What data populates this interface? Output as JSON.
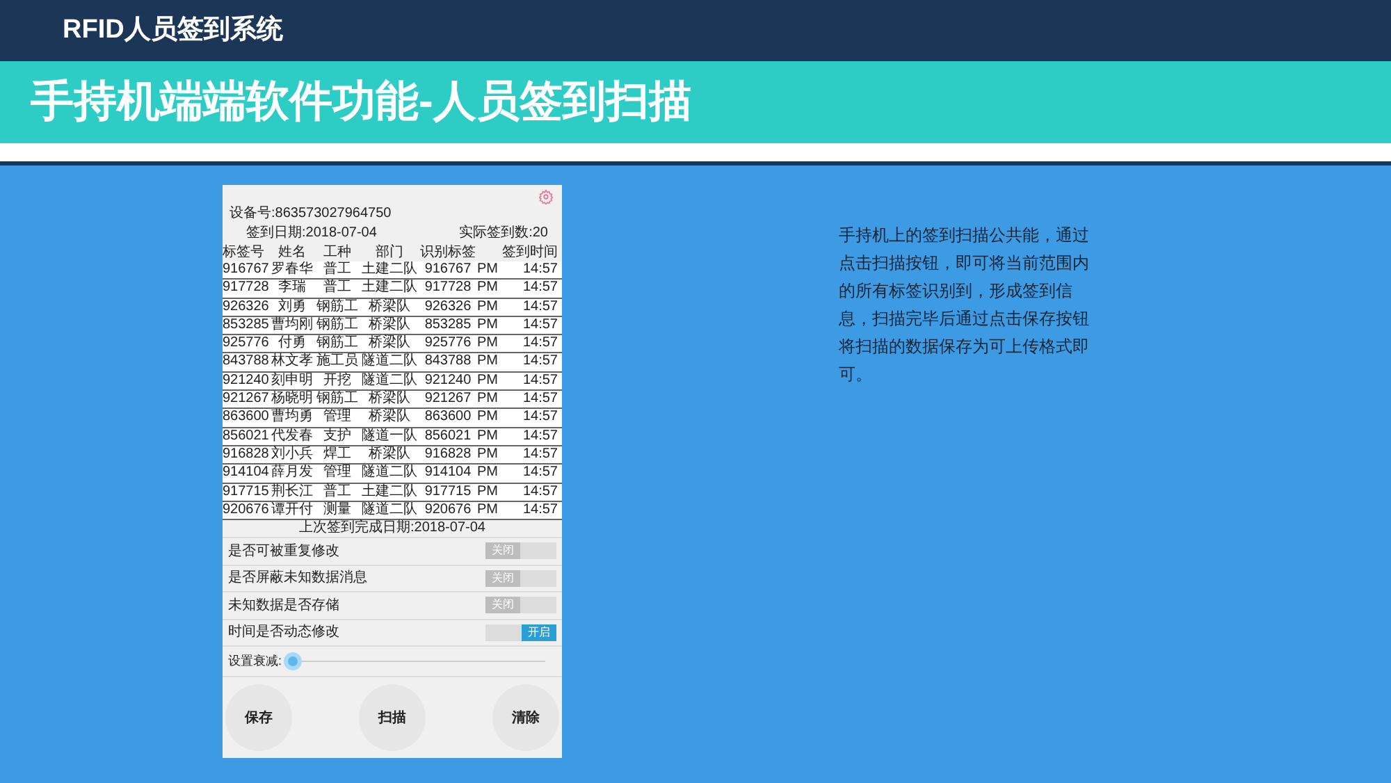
{
  "header": {
    "title": "RFID人员签到系统"
  },
  "banner": {
    "title": "手持机端端软件功能-人员签到扫描"
  },
  "phone": {
    "device": "设备号:863573027964750",
    "date": "签到日期:2018-07-04",
    "count": "实际签到数:20",
    "columns": [
      "标签号",
      "姓名",
      "工种",
      "部门",
      "识别标签",
      "签到时间"
    ],
    "rows": [
      {
        "tag": "916767",
        "name": "罗春华",
        "type": "普工",
        "dept": "土建二队",
        "id": "916767",
        "ampm": "PM",
        "time": "14:57"
      },
      {
        "tag": "917728",
        "name": "李瑞",
        "type": "普工",
        "dept": "土建二队",
        "id": "917728",
        "ampm": "PM",
        "time": "14:57"
      },
      {
        "tag": "926326",
        "name": "刘勇",
        "type": "钢筋工",
        "dept": "桥梁队",
        "id": "926326",
        "ampm": "PM",
        "time": "14:57"
      },
      {
        "tag": "853285",
        "name": "曹均刚",
        "type": "钢筋工",
        "dept": "桥梁队",
        "id": "853285",
        "ampm": "PM",
        "time": "14:57"
      },
      {
        "tag": "925776",
        "name": "付勇",
        "type": "钢筋工",
        "dept": "桥梁队",
        "id": "925776",
        "ampm": "PM",
        "time": "14:57"
      },
      {
        "tag": "843788",
        "name": "林文孝",
        "type": "施工员",
        "dept": "隧道二队",
        "id": "843788",
        "ampm": "PM",
        "time": "14:57"
      },
      {
        "tag": "921240",
        "name": "刻申明",
        "type": "开挖",
        "dept": "隧道二队",
        "id": "921240",
        "ampm": "PM",
        "time": "14:57"
      },
      {
        "tag": "921267",
        "name": "杨晓明",
        "type": "钢筋工",
        "dept": "桥梁队",
        "id": "921267",
        "ampm": "PM",
        "time": "14:57"
      },
      {
        "tag": "863600",
        "name": "曹均勇",
        "type": "管理",
        "dept": "桥梁队",
        "id": "863600",
        "ampm": "PM",
        "time": "14:57"
      },
      {
        "tag": "856021",
        "name": "代发春",
        "type": "支护",
        "dept": "隧道一队",
        "id": "856021",
        "ampm": "PM",
        "time": "14:57"
      },
      {
        "tag": "916828",
        "name": "刘小兵",
        "type": "焊工",
        "dept": "桥梁队",
        "id": "916828",
        "ampm": "PM",
        "time": "14:57"
      },
      {
        "tag": "914104",
        "name": "薛月发",
        "type": "管理",
        "dept": "隧道二队",
        "id": "914104",
        "ampm": "PM",
        "time": "14:57"
      },
      {
        "tag": "917715",
        "name": "荆长江",
        "type": "普工",
        "dept": "土建二队",
        "id": "917715",
        "ampm": "PM",
        "time": "14:57"
      },
      {
        "tag": "920676",
        "name": "谭开付",
        "type": "测量",
        "dept": "隧道二队",
        "id": "920676",
        "ampm": "PM",
        "time": "14:57"
      }
    ],
    "last_date": "上次签到完成日期:2018-07-04",
    "settings": [
      {
        "label": "是否可被重复修改",
        "on": false,
        "state": "关闭"
      },
      {
        "label": "是否屏蔽未知数据消息",
        "on": false,
        "state": "关闭"
      },
      {
        "label": "未知数据是否存储",
        "on": false,
        "state": "关闭"
      },
      {
        "label": "时间是否动态修改",
        "on": true,
        "state": "开启"
      }
    ],
    "slider": {
      "label": "设置衰减:",
      "level": 0
    },
    "buttons": [
      "保存",
      "扫描",
      "清除"
    ]
  },
  "description": "手持机上的签到扫描公共能，通过点击扫描按钮，即可将当前范围内的所有标签识别到，形成签到信息，扫描完毕后通过点击保存按钮将扫描的数据保存为可上传格式即可。"
}
